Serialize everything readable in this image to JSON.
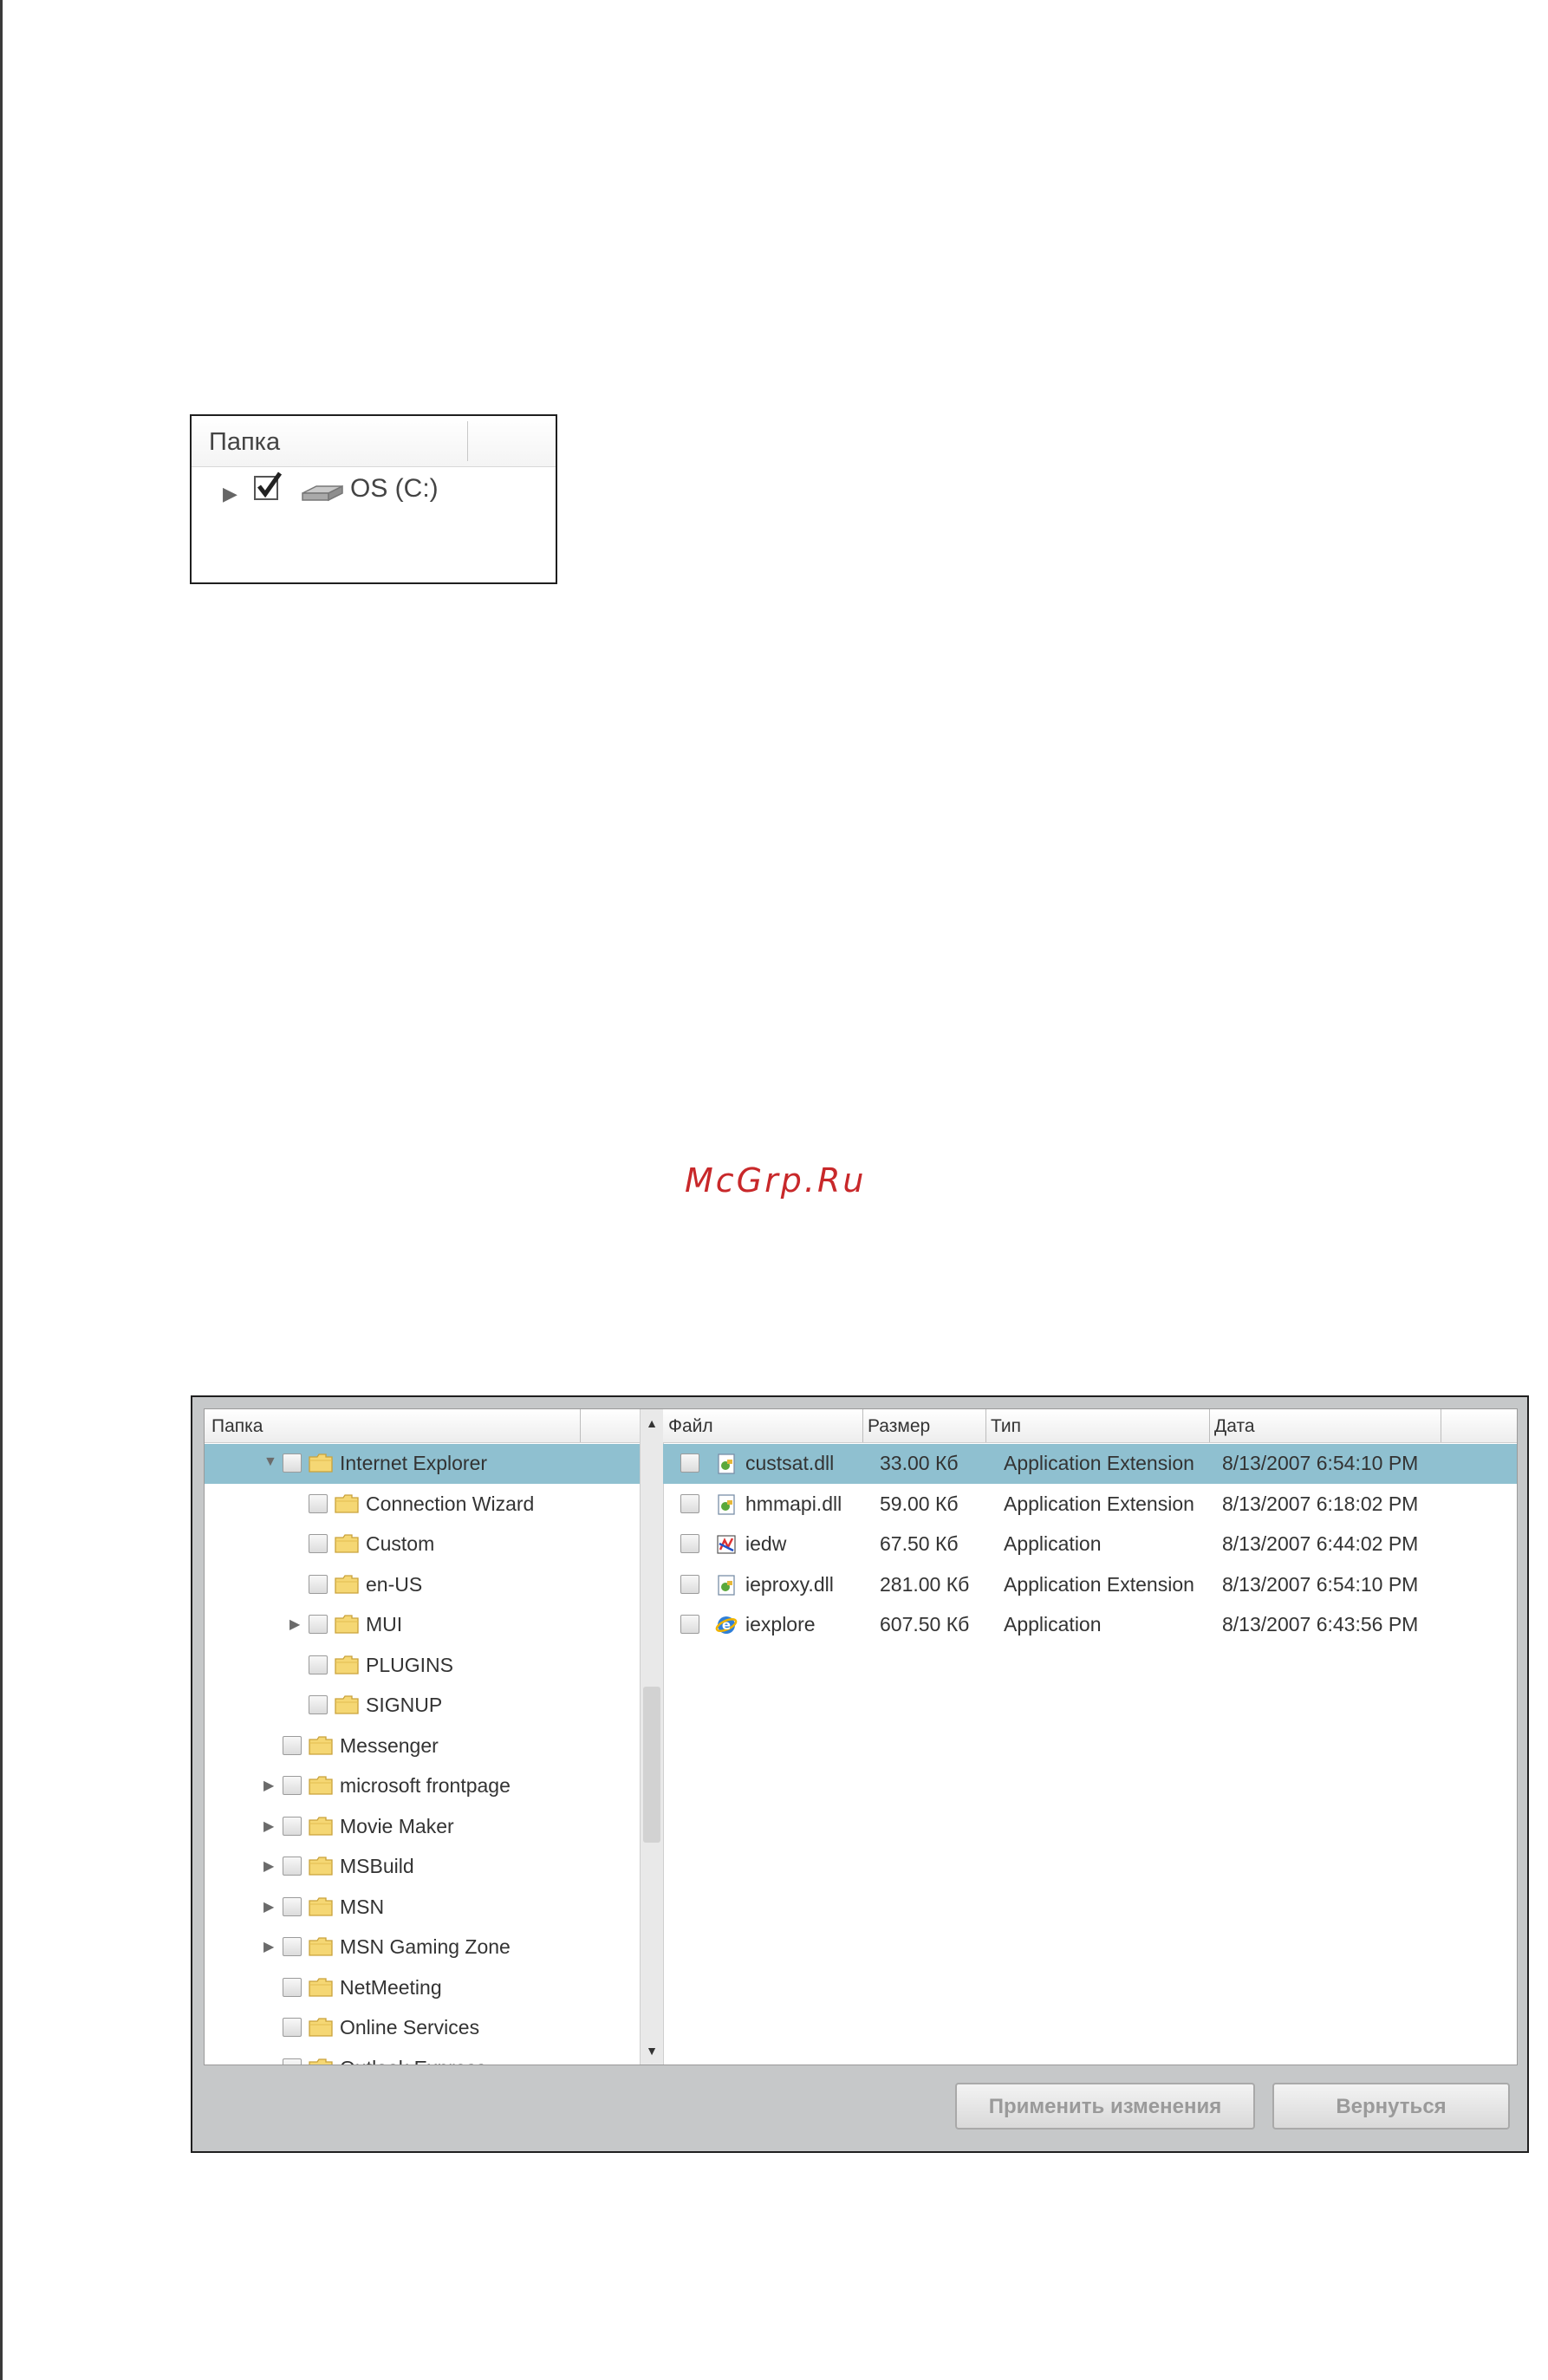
{
  "small_panel": {
    "header": "Папка",
    "row": {
      "label": "OS (C:)",
      "checked": true,
      "icon": "drive-icon"
    }
  },
  "watermark": "McGrp.Ru",
  "dialog": {
    "folder_header": "Папка",
    "file_headers": {
      "file": "Файл",
      "size": "Размер",
      "type": "Тип",
      "date": "Дата"
    },
    "folders": [
      {
        "label": "Internet Explorer",
        "level": 0,
        "expanded": true,
        "has_children": true,
        "selected": true
      },
      {
        "label": "Connection Wizard",
        "level": 1,
        "has_children": false
      },
      {
        "label": "Custom",
        "level": 1,
        "has_children": false
      },
      {
        "label": "en-US",
        "level": 1,
        "has_children": false
      },
      {
        "label": "MUI",
        "level": 1,
        "has_children": true
      },
      {
        "label": "PLUGINS",
        "level": 1,
        "has_children": false
      },
      {
        "label": "SIGNUP",
        "level": 1,
        "has_children": false
      },
      {
        "label": "Messenger",
        "level": 0,
        "has_children": false
      },
      {
        "label": "microsoft frontpage",
        "level": 0,
        "has_children": true
      },
      {
        "label": "Movie Maker",
        "level": 0,
        "has_children": true
      },
      {
        "label": "MSBuild",
        "level": 0,
        "has_children": true
      },
      {
        "label": "MSN",
        "level": 0,
        "has_children": true
      },
      {
        "label": "MSN Gaming Zone",
        "level": 0,
        "has_children": true
      },
      {
        "label": "NetMeeting",
        "level": 0,
        "has_children": false
      },
      {
        "label": "Online Services",
        "level": 0,
        "has_children": false
      },
      {
        "label": "Outlook Express",
        "level": 0,
        "has_children": false
      }
    ],
    "files": [
      {
        "name": "custsat.dll",
        "size": "33.00 Кб",
        "type": "Application Extension",
        "date": "8/13/2007 6:54:10 PM",
        "icon": "dll-icon",
        "selected": true
      },
      {
        "name": "hmmapi.dll",
        "size": "59.00 Кб",
        "type": "Application Extension",
        "date": "8/13/2007 6:18:02 PM",
        "icon": "dll-icon"
      },
      {
        "name": "iedw",
        "size": "67.50 Кб",
        "type": "Application",
        "date": "8/13/2007 6:44:02 PM",
        "icon": "app-icon"
      },
      {
        "name": "ieproxy.dll",
        "size": "281.00 Кб",
        "type": "Application Extension",
        "date": "8/13/2007 6:54:10 PM",
        "icon": "dll-icon"
      },
      {
        "name": "iexplore",
        "size": "607.50 Кб",
        "type": "Application",
        "date": "8/13/2007 6:43:56 PM",
        "icon": "ie-icon"
      }
    ],
    "buttons": {
      "apply": "Применить изменения",
      "back": "Вернуться"
    }
  }
}
